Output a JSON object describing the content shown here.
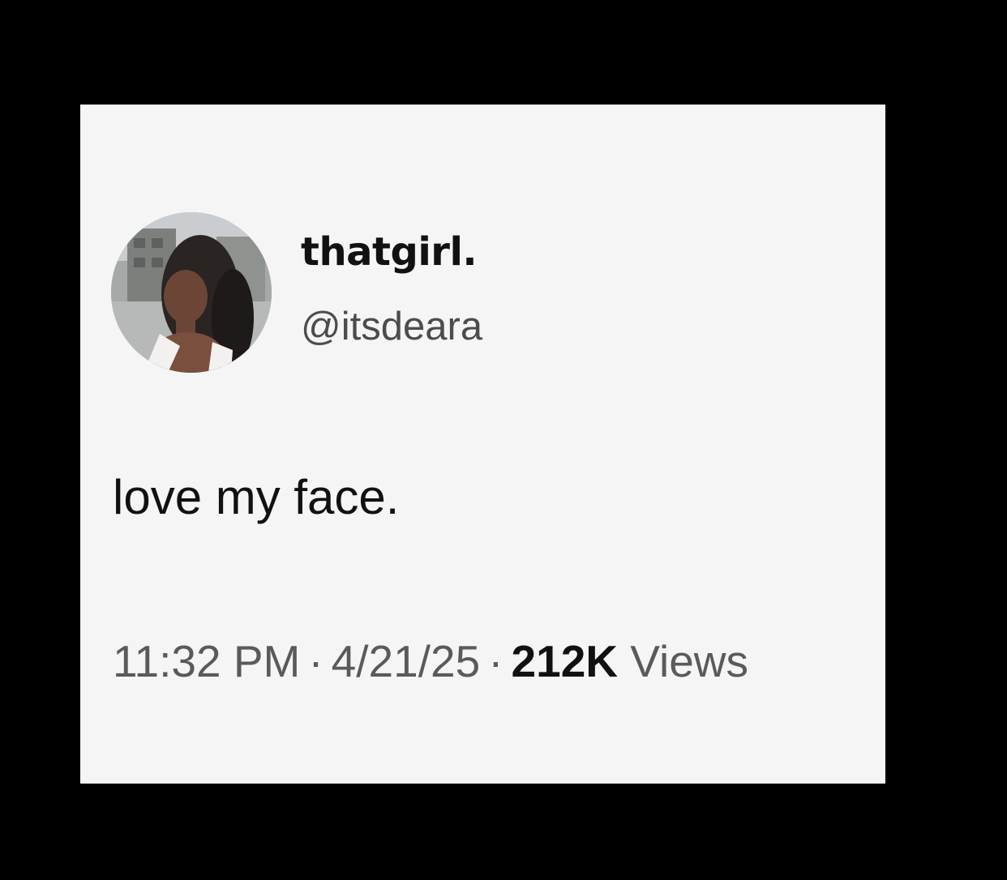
{
  "tweet": {
    "display_name": "thatgirl.",
    "handle": "@itsdeara",
    "text": "love my face.",
    "time": "11:32 PM",
    "date": "4/21/25",
    "separator": "·",
    "views_count": "212K",
    "views_label": "Views"
  },
  "icons": {
    "avatar": "profile-photo"
  },
  "colors": {
    "page_background": "#000000",
    "card_background": "#f6f5f6",
    "primary_text": "#111111",
    "secondary_text": "#5a5a5a"
  }
}
